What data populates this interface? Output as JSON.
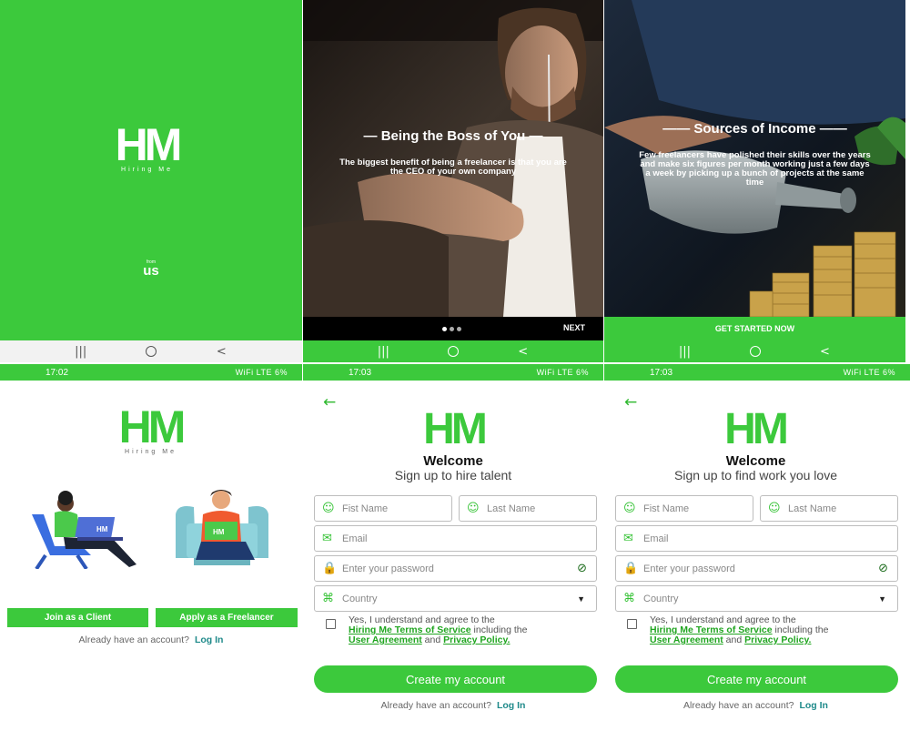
{
  "splash": {
    "logo_text": "HM",
    "logo_sub": "Hiring Me",
    "brand_small": "us",
    "brand_from": "from"
  },
  "slide1": {
    "title": "Being the Boss of You",
    "text": "The biggest benefit of being a freelancer is that you are the CEO of your own company",
    "next_label": "NEXT"
  },
  "slide2": {
    "title": "Sources of Income",
    "text": "Few freelancers have polished their skills over the years and make six figures per month working just a few days a week by picking up a bunch of projects at the same time",
    "cta_label": "GET STARTED NOW"
  },
  "home": {
    "status_time": "17:02",
    "status_right": "WiFi LTE 6%",
    "logo_text": "HM",
    "logo_sub": "Hiring Me",
    "illus_badge": "HM",
    "client_label": "Join as a Client",
    "freelancer_label": "Apply as a Freelancer",
    "already": "Already have an account?",
    "login": "Log In"
  },
  "signup_client": {
    "status_time": "17:03",
    "status_right": "WiFi LTE 6%",
    "logo_text": "HM",
    "welcome": "Welcome",
    "subtitle": "Sign up to hire talent",
    "first_name": "Fist Name",
    "last_name": "Last Name",
    "email": "Email",
    "password": "Enter your password",
    "country": "Country",
    "terms_1": "Yes, I understand and agree to the",
    "terms_link_1": "Hiring Me Terms of Service",
    "terms_2": "including the",
    "terms_link_2": "User Agreement",
    "terms_3": "and",
    "terms_link_3": "Privacy Policy.",
    "create": "Create my account",
    "already": "Already have an account?",
    "login": "Log In"
  },
  "signup_freelancer": {
    "status_time": "17:03",
    "status_right": "WiFi LTE 6%",
    "logo_text": "HM",
    "welcome": "Welcome",
    "subtitle": "Sign up to find work you love",
    "first_name": "Fist Name",
    "last_name": "Last Name",
    "email": "Email",
    "password": "Enter your password",
    "country": "Country",
    "terms_1": "Yes, I understand and agree to the",
    "terms_link_1": "Hiring Me Terms of Service",
    "terms_2": "including the",
    "terms_link_2": "User Agreement",
    "terms_3": "and",
    "terms_link_3": "Privacy Policy.",
    "create": "Create my account",
    "already": "Already have an account?",
    "login": "Log In"
  },
  "nav": {
    "recents": "|||",
    "back": "<"
  },
  "colors": {
    "brand_green": "#3cc93c",
    "link_green": "#20a520",
    "login_teal": "#1f8a8a"
  },
  "icons": [
    "person-icon",
    "email-icon",
    "lock-icon",
    "eye-slash-icon",
    "globe-icon",
    "back-arrow-icon",
    "home-icon"
  ]
}
